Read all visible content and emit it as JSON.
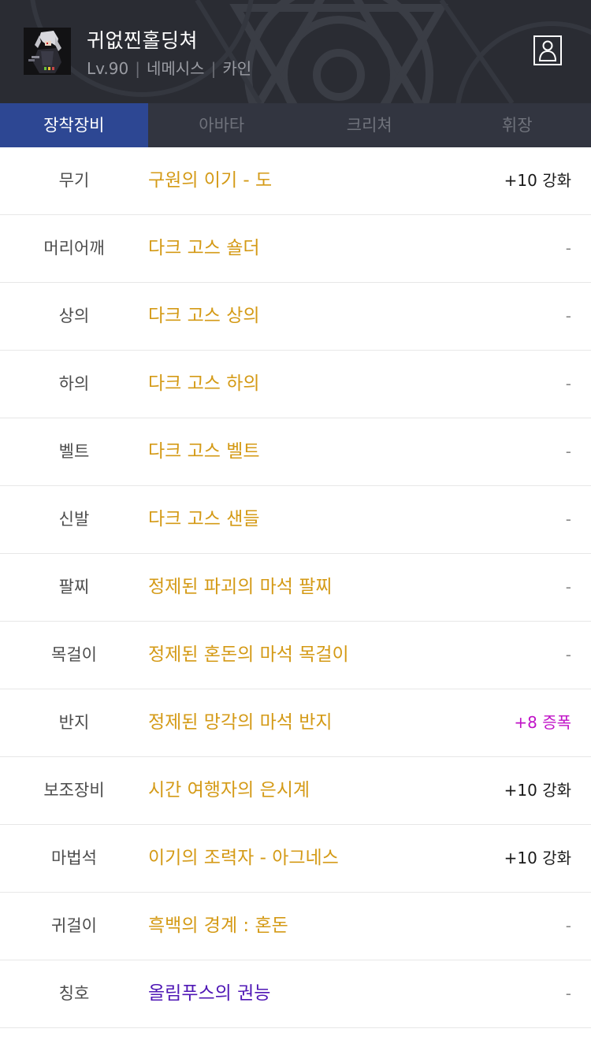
{
  "character": {
    "name": "귀없찐홀딩쳐",
    "level": "Lv.90",
    "server": "네메시스",
    "job": "카인",
    "separator": "|"
  },
  "icons": {
    "profile": "person-icon",
    "avatar": "character-portrait"
  },
  "colors": {
    "header_bg": "#2a2c33",
    "tab_active_bg": "#2d4793",
    "item_unique": "#d49a16",
    "item_epic_title": "#4f17b5",
    "reinforce": "#1a1a1a",
    "amplify": "#c013c7",
    "none": "#8a8a8a"
  },
  "tabs": [
    {
      "label": "장착장비",
      "active": true
    },
    {
      "label": "아바타",
      "active": false
    },
    {
      "label": "크리쳐",
      "active": false
    },
    {
      "label": "휘장",
      "active": false
    }
  ],
  "equipment": [
    {
      "slot": "무기",
      "item": "구원의 이기 - 도",
      "status": "+10 강화",
      "item_color": "#d49a16",
      "status_color": "#1a1a1a"
    },
    {
      "slot": "머리어깨",
      "item": "다크 고스 숄더",
      "status": "-",
      "item_color": "#d49a16",
      "status_color": "#8a8a8a"
    },
    {
      "slot": "상의",
      "item": "다크 고스 상의",
      "status": "-",
      "item_color": "#d49a16",
      "status_color": "#8a8a8a"
    },
    {
      "slot": "하의",
      "item": "다크 고스 하의",
      "status": "-",
      "item_color": "#d49a16",
      "status_color": "#8a8a8a"
    },
    {
      "slot": "벨트",
      "item": "다크 고스 벨트",
      "status": "-",
      "item_color": "#d49a16",
      "status_color": "#8a8a8a"
    },
    {
      "slot": "신발",
      "item": "다크 고스 샌들",
      "status": "-",
      "item_color": "#d49a16",
      "status_color": "#8a8a8a"
    },
    {
      "slot": "팔찌",
      "item": "정제된 파괴의 마석 팔찌",
      "status": "-",
      "item_color": "#d49a16",
      "status_color": "#8a8a8a"
    },
    {
      "slot": "목걸이",
      "item": "정제된 혼돈의 마석 목걸이",
      "status": "-",
      "item_color": "#d49a16",
      "status_color": "#8a8a8a"
    },
    {
      "slot": "반지",
      "item": "정제된 망각의 마석 반지",
      "status": "+8 증폭",
      "item_color": "#d49a16",
      "status_color": "#c013c7"
    },
    {
      "slot": "보조장비",
      "item": "시간 여행자의 은시계",
      "status": "+10 강화",
      "item_color": "#d49a16",
      "status_color": "#1a1a1a"
    },
    {
      "slot": "마법석",
      "item": "이기의 조력자 - 아그네스",
      "status": "+10 강화",
      "item_color": "#d49a16",
      "status_color": "#1a1a1a"
    },
    {
      "slot": "귀걸이",
      "item": "흑백의 경계 : 혼돈",
      "status": "-",
      "item_color": "#d49a16",
      "status_color": "#8a8a8a"
    },
    {
      "slot": "칭호",
      "item": "올림푸스의 권능",
      "status": "-",
      "item_color": "#4f17b5",
      "status_color": "#8a8a8a"
    }
  ]
}
